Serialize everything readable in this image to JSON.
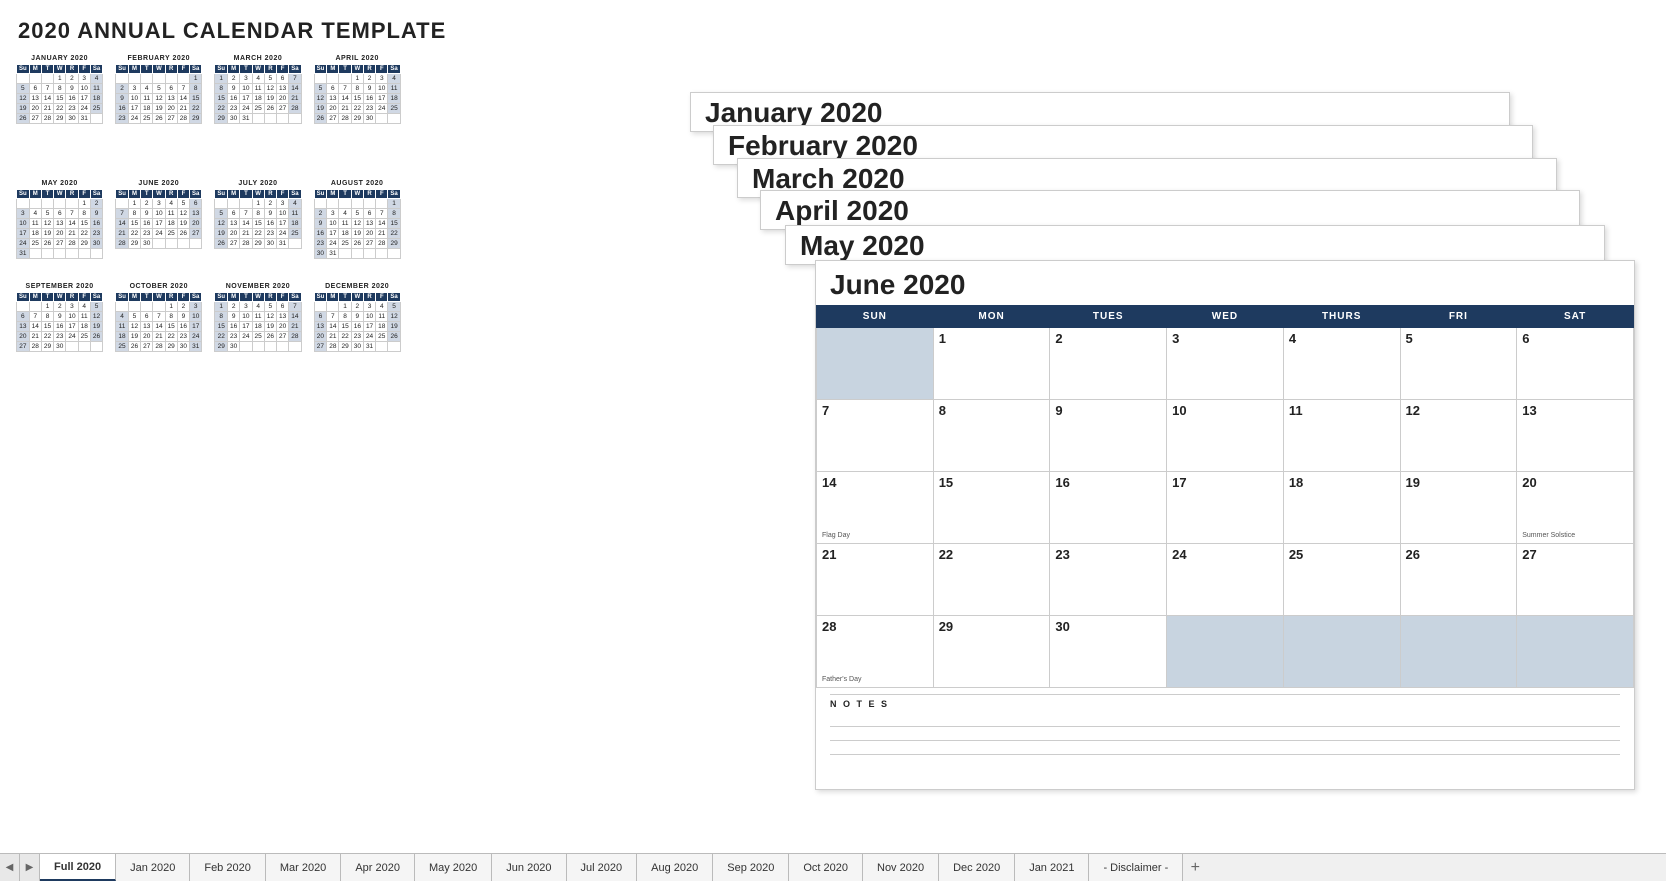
{
  "title": "2020 ANNUAL CALENDAR TEMPLATE",
  "notes_label": "— N O T E S —",
  "months": [
    {
      "name": "JANUARY 2020",
      "headers": [
        "Su",
        "M",
        "T",
        "W",
        "R",
        "F",
        "Sa"
      ],
      "weeks": [
        [
          "",
          "",
          "",
          "1",
          "2",
          "3",
          "4"
        ],
        [
          "5",
          "6",
          "7",
          "8",
          "9",
          "10",
          "11"
        ],
        [
          "12",
          "13",
          "14",
          "15",
          "16",
          "17",
          "18"
        ],
        [
          "19",
          "20",
          "21",
          "22",
          "23",
          "24",
          "25"
        ],
        [
          "26",
          "27",
          "28",
          "29",
          "30",
          "31",
          ""
        ]
      ]
    },
    {
      "name": "FEBRUARY 2020",
      "headers": [
        "Su",
        "M",
        "T",
        "W",
        "R",
        "F",
        "Sa"
      ],
      "weeks": [
        [
          "",
          "",
          "",
          "",
          "",
          "",
          "1"
        ],
        [
          "2",
          "3",
          "4",
          "5",
          "6",
          "7",
          "8"
        ],
        [
          "9",
          "10",
          "11",
          "12",
          "13",
          "14",
          "15"
        ],
        [
          "16",
          "17",
          "18",
          "19",
          "20",
          "21",
          "22"
        ],
        [
          "23",
          "24",
          "25",
          "26",
          "27",
          "28",
          "29"
        ]
      ]
    },
    {
      "name": "MARCH 2020",
      "headers": [
        "Su",
        "M",
        "T",
        "W",
        "R",
        "F",
        "Sa"
      ],
      "weeks": [
        [
          "1",
          "2",
          "3",
          "4",
          "5",
          "6",
          "7"
        ],
        [
          "8",
          "9",
          "10",
          "11",
          "12",
          "13",
          "14"
        ],
        [
          "15",
          "16",
          "17",
          "18",
          "19",
          "20",
          "21"
        ],
        [
          "22",
          "23",
          "24",
          "25",
          "26",
          "27",
          "28"
        ],
        [
          "29",
          "30",
          "31",
          "",
          "",
          "",
          ""
        ]
      ]
    },
    {
      "name": "APRIL 2020",
      "headers": [
        "Su",
        "M",
        "T",
        "W",
        "R",
        "F",
        "Sa"
      ],
      "weeks": [
        [
          "",
          "",
          "",
          "1",
          "2",
          "3",
          "4"
        ],
        [
          "5",
          "6",
          "7",
          "8",
          "9",
          "10",
          "11"
        ],
        [
          "12",
          "13",
          "14",
          "15",
          "16",
          "17",
          "18"
        ],
        [
          "19",
          "20",
          "21",
          "22",
          "23",
          "24",
          "25"
        ],
        [
          "26",
          "27",
          "28",
          "29",
          "30",
          "",
          ""
        ]
      ]
    },
    {
      "name": "MAY 2020",
      "headers": [
        "Su",
        "M",
        "T",
        "W",
        "R",
        "F",
        "Sa"
      ],
      "weeks": [
        [
          "",
          "",
          "",
          "",
          "",
          "1",
          "2"
        ],
        [
          "3",
          "4",
          "5",
          "6",
          "7",
          "8",
          "9"
        ],
        [
          "10",
          "11",
          "12",
          "13",
          "14",
          "15",
          "16"
        ],
        [
          "17",
          "18",
          "19",
          "20",
          "21",
          "22",
          "23"
        ],
        [
          "24",
          "25",
          "26",
          "27",
          "28",
          "29",
          "30"
        ],
        [
          "31",
          "",
          "",
          "",
          "",
          "",
          ""
        ]
      ]
    },
    {
      "name": "JUNE 2020",
      "headers": [
        "Su",
        "M",
        "T",
        "W",
        "R",
        "F",
        "Sa"
      ],
      "weeks": [
        [
          "",
          "1",
          "2",
          "3",
          "4",
          "5",
          "6"
        ],
        [
          "7",
          "8",
          "9",
          "10",
          "11",
          "12",
          "13"
        ],
        [
          "14",
          "15",
          "16",
          "17",
          "18",
          "19",
          "20"
        ],
        [
          "21",
          "22",
          "23",
          "24",
          "25",
          "26",
          "27"
        ],
        [
          "28",
          "29",
          "30",
          "",
          "",
          "",
          ""
        ]
      ]
    },
    {
      "name": "JULY 2020",
      "headers": [
        "Su",
        "M",
        "T",
        "W",
        "R",
        "F",
        "Sa"
      ],
      "weeks": [
        [
          "",
          "",
          "",
          "1",
          "2",
          "3",
          "4"
        ],
        [
          "5",
          "6",
          "7",
          "8",
          "9",
          "10",
          "11"
        ],
        [
          "12",
          "13",
          "14",
          "15",
          "16",
          "17",
          "18"
        ],
        [
          "19",
          "20",
          "21",
          "22",
          "23",
          "24",
          "25"
        ],
        [
          "26",
          "27",
          "28",
          "29",
          "30",
          "31",
          ""
        ]
      ]
    },
    {
      "name": "AUGUST 2020",
      "headers": [
        "Su",
        "M",
        "T",
        "W",
        "R",
        "F",
        "Sa"
      ],
      "weeks": [
        [
          "",
          "",
          "",
          "",
          "",
          "",
          "1"
        ],
        [
          "2",
          "3",
          "4",
          "5",
          "6",
          "7",
          "8"
        ],
        [
          "9",
          "10",
          "11",
          "12",
          "13",
          "14",
          "15"
        ],
        [
          "16",
          "17",
          "18",
          "19",
          "20",
          "21",
          "22"
        ],
        [
          "23",
          "24",
          "25",
          "26",
          "27",
          "28",
          "29"
        ],
        [
          "30",
          "31",
          "",
          "",
          "",
          "",
          ""
        ]
      ]
    },
    {
      "name": "SEPTEMBER 2020",
      "headers": [
        "Su",
        "M",
        "T",
        "W",
        "R",
        "F",
        "Sa"
      ],
      "weeks": [
        [
          "",
          "",
          "1",
          "2",
          "3",
          "4",
          "5"
        ],
        [
          "6",
          "7",
          "8",
          "9",
          "10",
          "11",
          "12"
        ],
        [
          "13",
          "14",
          "15",
          "16",
          "17",
          "18",
          "19"
        ],
        [
          "20",
          "21",
          "22",
          "23",
          "24",
          "25",
          "26"
        ],
        [
          "27",
          "28",
          "29",
          "30",
          "",
          "",
          ""
        ]
      ]
    },
    {
      "name": "OCTOBER 2020",
      "headers": [
        "Su",
        "M",
        "T",
        "W",
        "R",
        "F",
        "Sa"
      ],
      "weeks": [
        [
          "",
          "",
          "",
          "",
          "1",
          "2",
          "3"
        ],
        [
          "4",
          "5",
          "6",
          "7",
          "8",
          "9",
          "10"
        ],
        [
          "11",
          "12",
          "13",
          "14",
          "15",
          "16",
          "17"
        ],
        [
          "18",
          "19",
          "20",
          "21",
          "22",
          "23",
          "24"
        ],
        [
          "25",
          "26",
          "27",
          "28",
          "29",
          "30",
          "31"
        ]
      ]
    },
    {
      "name": "NOVEMBER 2020",
      "headers": [
        "Su",
        "M",
        "T",
        "W",
        "R",
        "F",
        "Sa"
      ],
      "weeks": [
        [
          "1",
          "2",
          "3",
          "4",
          "5",
          "6",
          "7"
        ],
        [
          "8",
          "9",
          "10",
          "11",
          "12",
          "13",
          "14"
        ],
        [
          "15",
          "16",
          "17",
          "18",
          "19",
          "20",
          "21"
        ],
        [
          "22",
          "23",
          "24",
          "25",
          "26",
          "27",
          "28"
        ],
        [
          "29",
          "30",
          "",
          "",
          "",
          "",
          ""
        ]
      ]
    },
    {
      "name": "DECEMBER 2020",
      "headers": [
        "Su",
        "M",
        "T",
        "W",
        "R",
        "F",
        "Sa"
      ],
      "weeks": [
        [
          "",
          "",
          "1",
          "2",
          "3",
          "4",
          "5"
        ],
        [
          "6",
          "7",
          "8",
          "9",
          "10",
          "11",
          "12"
        ],
        [
          "13",
          "14",
          "15",
          "16",
          "17",
          "18",
          "19"
        ],
        [
          "20",
          "21",
          "22",
          "23",
          "24",
          "25",
          "26"
        ],
        [
          "27",
          "28",
          "29",
          "30",
          "31",
          "",
          ""
        ]
      ]
    }
  ],
  "june_full": {
    "title": "June 2020",
    "headers": [
      "SUN",
      "MON",
      "TUES",
      "WED",
      "THURS",
      "FRI",
      "SAT"
    ],
    "weeks": [
      [
        {
          "d": "",
          "inactive": true
        },
        {
          "d": "1"
        },
        {
          "d": "2"
        },
        {
          "d": "3"
        },
        {
          "d": "4"
        },
        {
          "d": "5"
        },
        {
          "d": "6"
        }
      ],
      [
        {
          "d": "7"
        },
        {
          "d": "8"
        },
        {
          "d": "9"
        },
        {
          "d": "10"
        },
        {
          "d": "11"
        },
        {
          "d": "12"
        },
        {
          "d": "13"
        }
      ],
      [
        {
          "d": "14",
          "event": "Flag Day"
        },
        {
          "d": "15"
        },
        {
          "d": "16"
        },
        {
          "d": "17"
        },
        {
          "d": "18"
        },
        {
          "d": "19"
        },
        {
          "d": "20",
          "event": "Summer Solstice"
        }
      ],
      [
        {
          "d": "21"
        },
        {
          "d": "22"
        },
        {
          "d": "23"
        },
        {
          "d": "24"
        },
        {
          "d": "25"
        },
        {
          "d": "26"
        },
        {
          "d": "27"
        }
      ],
      [
        {
          "d": "28",
          "event": "Father's Day"
        },
        {
          "d": "29"
        },
        {
          "d": "30"
        },
        {
          "d": "",
          "inactive": true
        },
        {
          "d": "",
          "inactive": true
        },
        {
          "d": "",
          "inactive": true
        },
        {
          "d": "",
          "inactive": true
        }
      ]
    ],
    "notes_label": "N O T E S"
  },
  "stacked": [
    {
      "title": "January 2020"
    },
    {
      "title": "February 2020"
    },
    {
      "title": "March 2020"
    },
    {
      "title": "April 2020"
    },
    {
      "title": "May 2020"
    }
  ],
  "tabs": [
    {
      "label": "Full 2020",
      "active": true
    },
    {
      "label": "Jan 2020"
    },
    {
      "label": "Feb 2020"
    },
    {
      "label": "Mar 2020"
    },
    {
      "label": "Apr 2020"
    },
    {
      "label": "May 2020"
    },
    {
      "label": "Jun 2020"
    },
    {
      "label": "Jul 2020"
    },
    {
      "label": "Aug 2020"
    },
    {
      "label": "Sep 2020"
    },
    {
      "label": "Oct 2020"
    },
    {
      "label": "Nov 2020"
    },
    {
      "label": "Dec 2020"
    },
    {
      "label": "Jan 2021"
    },
    {
      "label": "- Disclaimer -"
    }
  ],
  "tab_nav": {
    "left": "◀",
    "right": "▶",
    "add": "+"
  }
}
